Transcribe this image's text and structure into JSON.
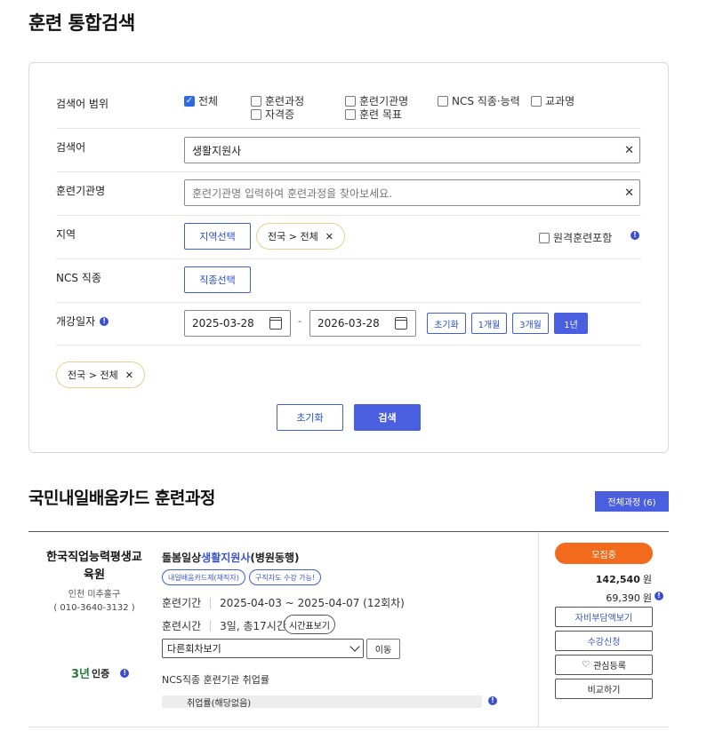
{
  "page": {
    "title": "훈련 통합검색"
  },
  "search": {
    "scope_label": "검색어 범위",
    "scope_options": [
      {
        "label": "전체",
        "checked": true
      },
      {
        "label": "훈련과정",
        "checked": false
      },
      {
        "label": "훈련기관명",
        "checked": false
      },
      {
        "label": "NCS 직종·능력",
        "checked": false
      },
      {
        "label": "교과명",
        "checked": false
      },
      {
        "label": "자격증",
        "checked": false
      },
      {
        "label": "훈련 목표",
        "checked": false
      }
    ],
    "keyword_label": "검색어",
    "keyword_value": "생활지원사",
    "institution_label": "훈련기관명",
    "institution_placeholder": "훈련기관명 입력하여 훈련과정을 찾아보세요.",
    "region_label": "지역",
    "region_button": "지역선택",
    "region_chip": "전국 > 전체",
    "remote_label": "원격훈련포함",
    "ncs_label": "NCS 직종",
    "ncs_button": "직종선택",
    "date_label": "개강일자",
    "date_from": "2025-03-28",
    "date_sep": "-",
    "date_to": "2026-03-28",
    "period_buttons": [
      "초기화",
      "1개월",
      "3개월",
      "1년"
    ],
    "period_active": "1년",
    "selected_chip": "전국 > 전체",
    "reset_label": "초기화",
    "search_label": "검색"
  },
  "results": {
    "section_title": "국민내일배움카드 훈련과정",
    "all_courses_label": "전체과정 (6)",
    "course": {
      "institution_name": "한국직업능력평생교육원",
      "institution_location": "인천 미추홀구",
      "institution_phone": "( 010-3640-3132 )",
      "cert_logo": "3년",
      "cert_label": "인증",
      "title_prefix": "돌봄일상",
      "title_highlight": "생활지원사",
      "title_suffix": "(병원동행)",
      "tags": [
        "내일배움카드제(재직자)",
        "구직자도 수강 가능!"
      ],
      "period_label": "훈련기간",
      "period_value": "2025-04-03 ~ 2025-04-07 (12회차)",
      "time_label": "훈련시간",
      "time_value": "3일, 총17시간",
      "timetable_label": "시간표보기",
      "session_select": "다른회차보기",
      "move_label": "이동",
      "ncs_rate_label": "NCS직종 훈련기관 취업률",
      "rate_value": "취업률(해당없음)",
      "status_badge": "모집중",
      "price_total": "142,540",
      "price_self": "69,390",
      "price_unit": "원",
      "btn_self_pay": "자비부담액보기",
      "btn_apply": "수강신청",
      "btn_favorite": "관심등록",
      "btn_compare": "비교하기"
    }
  },
  "colors": {
    "primary": "#4a5ee0",
    "accent_orange": "#f26a1b",
    "chip_border": "#e6d28a",
    "cert_green": "#2a7a3d"
  }
}
